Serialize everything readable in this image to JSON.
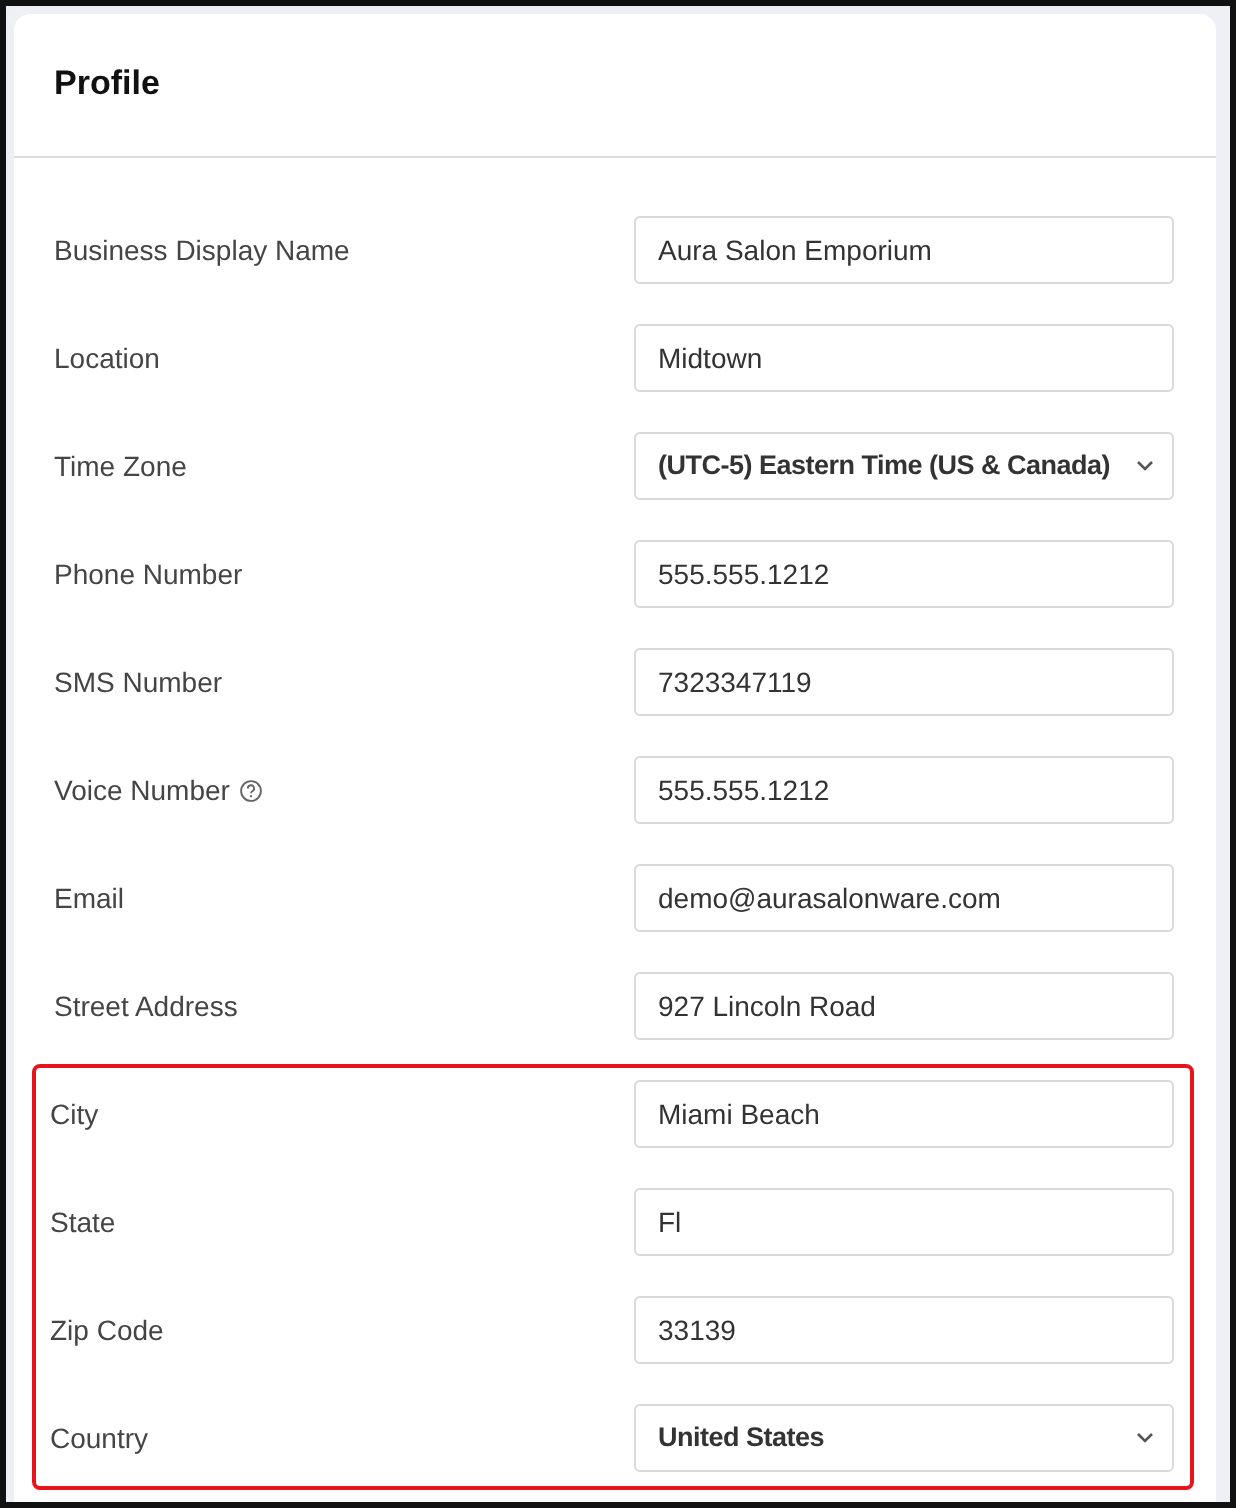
{
  "card": {
    "title": "Profile"
  },
  "fields": [
    {
      "label": "Business Display Name",
      "kind": "text",
      "value": "Aura Salon Emporium",
      "help": false
    },
    {
      "label": "Location",
      "kind": "text",
      "value": "Midtown",
      "help": false
    },
    {
      "label": "Time Zone",
      "kind": "select",
      "value": "(UTC-5) Eastern Time (US & Canada)",
      "help": false
    },
    {
      "label": "Phone Number",
      "kind": "text",
      "value": "555.555.1212",
      "help": false
    },
    {
      "label": "SMS Number",
      "kind": "text",
      "value": "7323347119",
      "help": false
    },
    {
      "label": "Voice Number",
      "kind": "text",
      "value": "555.555.1212",
      "help": true
    },
    {
      "label": "Email",
      "kind": "text",
      "value": "demo@aurasalonware.com",
      "help": false
    },
    {
      "label": "Street Address",
      "kind": "text",
      "value": "927 Lincoln Road",
      "help": false
    }
  ],
  "highlighted_fields": [
    {
      "label": "City",
      "kind": "text",
      "value": "Miami Beach",
      "help": false
    },
    {
      "label": "State",
      "kind": "text",
      "value": "Fl",
      "help": false
    },
    {
      "label": "Zip Code",
      "kind": "text",
      "value": "33139",
      "help": false
    },
    {
      "label": "Country",
      "kind": "select",
      "value": "United States",
      "help": false
    }
  ]
}
